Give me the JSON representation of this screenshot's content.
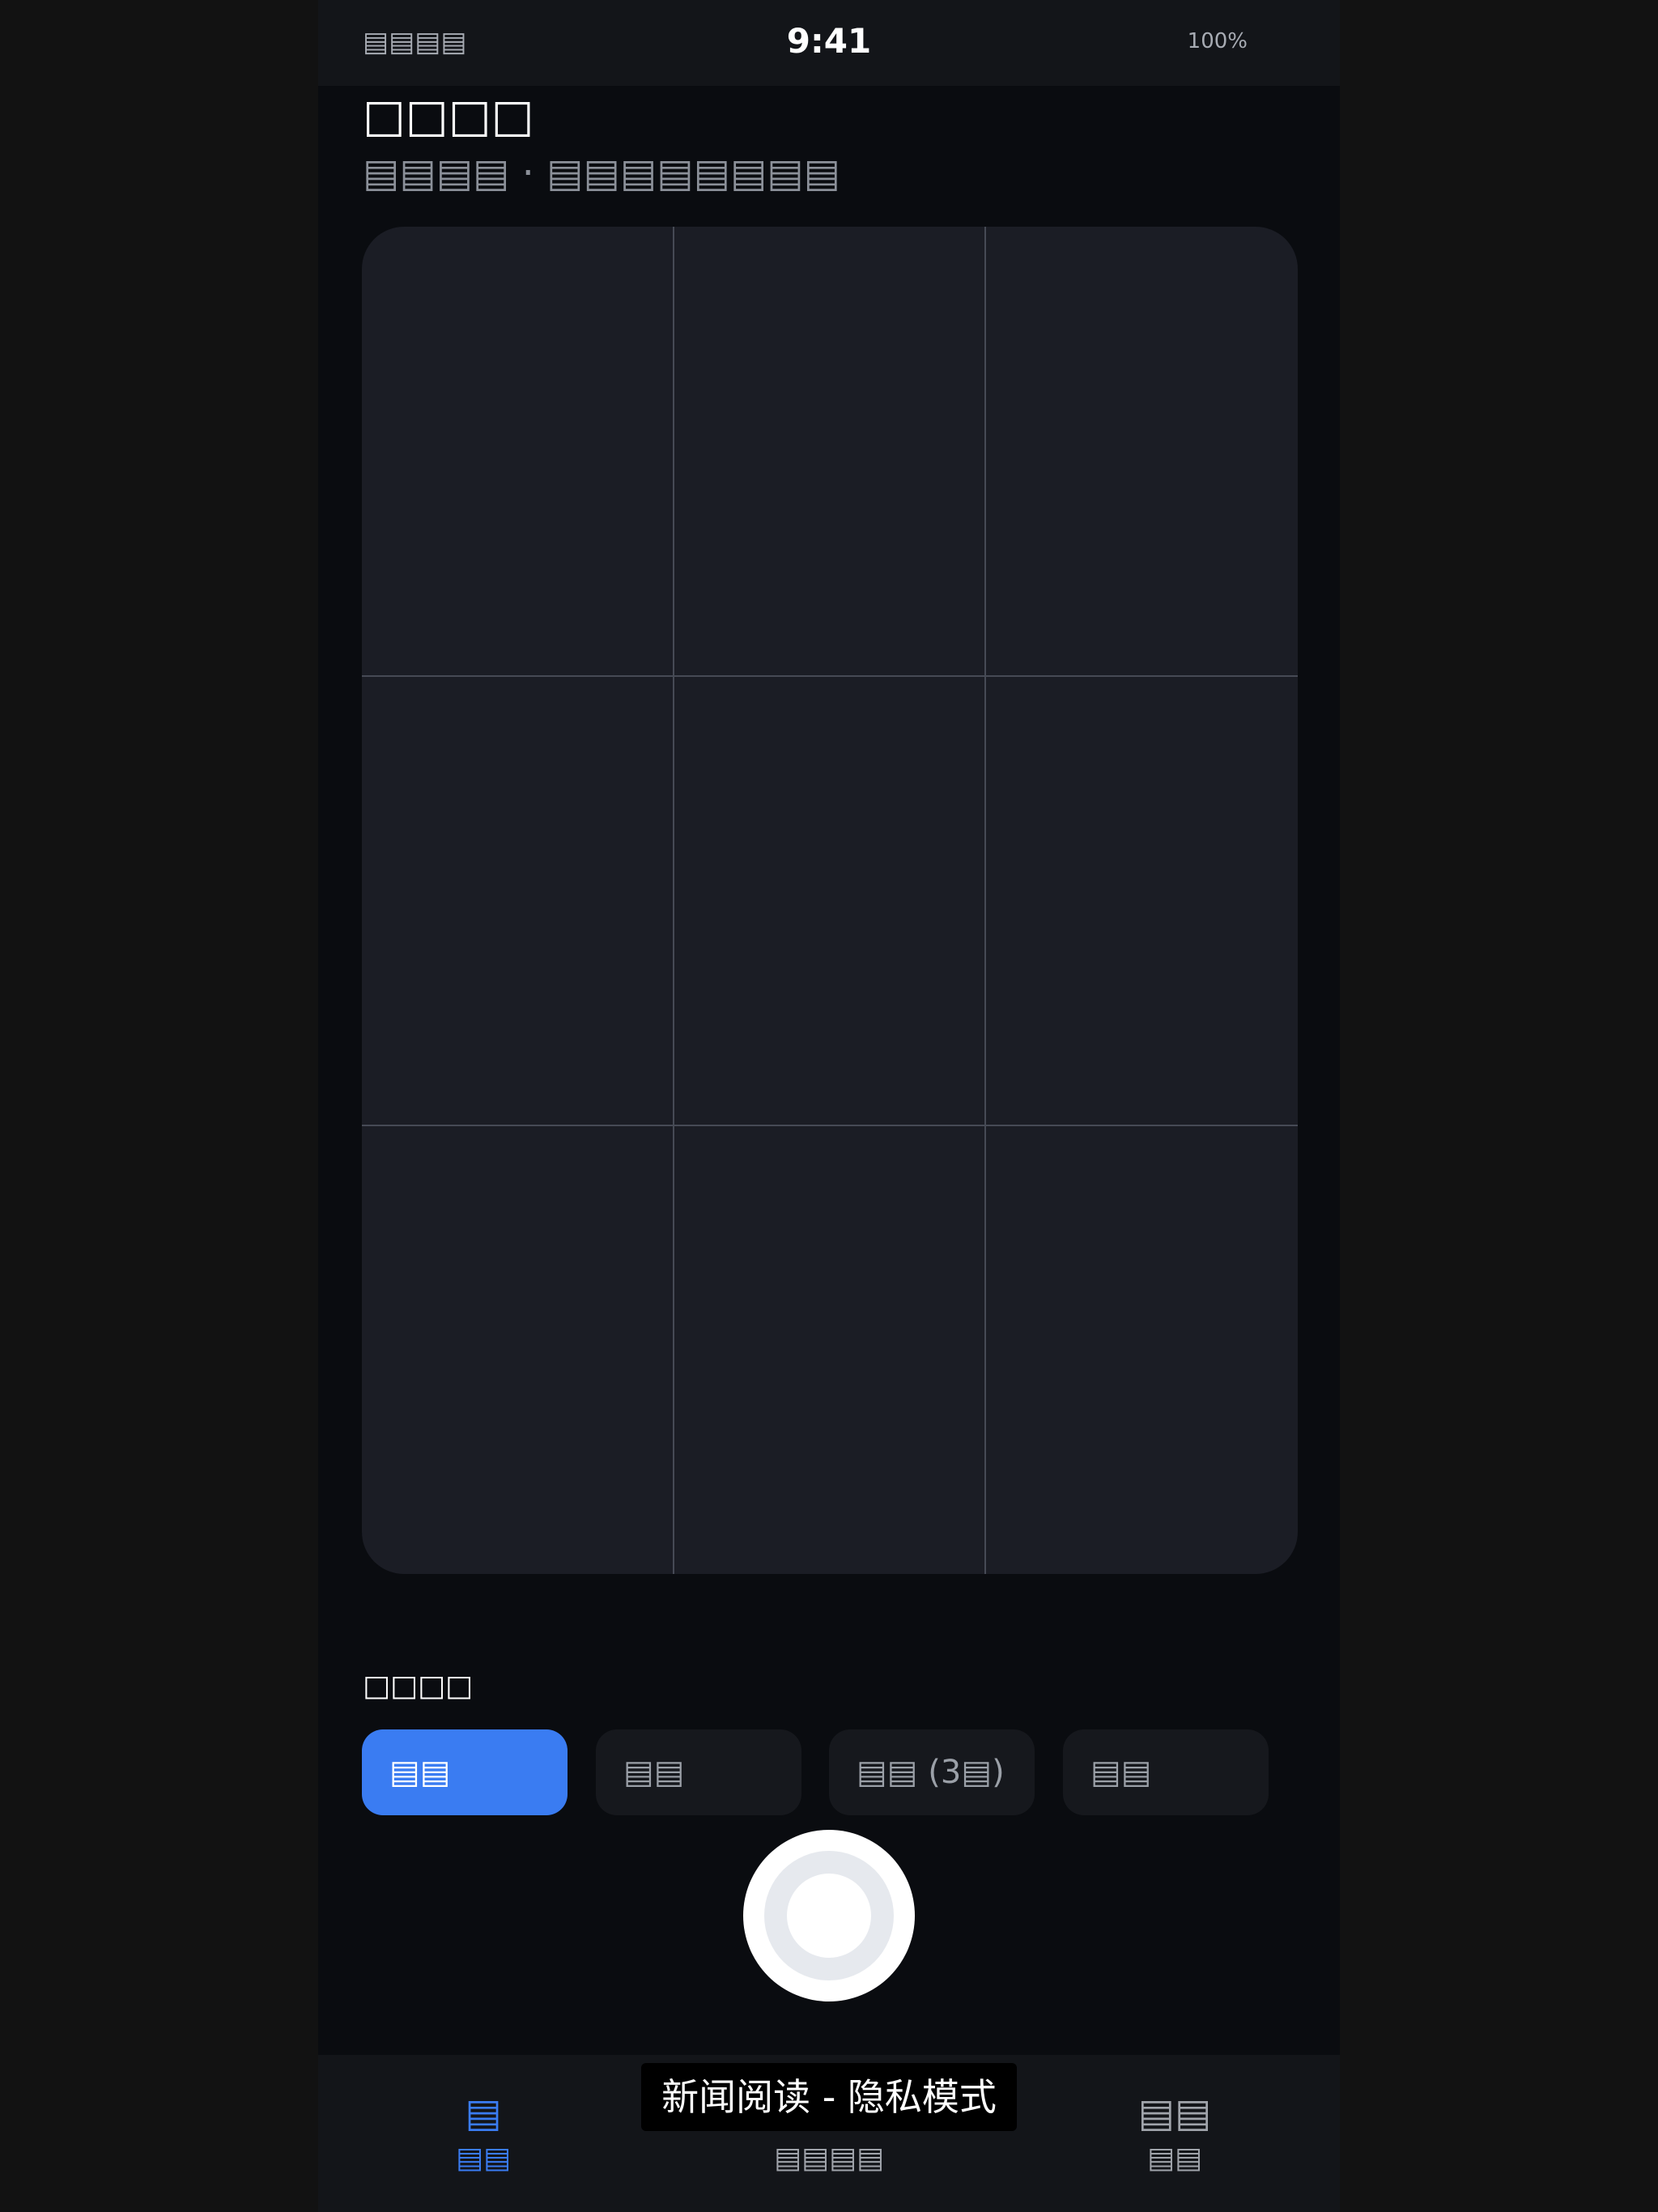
{
  "status_bar": {
    "carrier": "▤▤▤▤",
    "time": "9:41",
    "battery": "100%"
  },
  "header": {
    "title": "□□□□",
    "subtitle": "▤▤▤▤ · ▤▤▤▤▤▤▤▤"
  },
  "capture": {
    "mode_label": "□□□□",
    "modes": [
      {
        "label": "▤▤",
        "active": true
      },
      {
        "label": "▤▤",
        "active": false
      },
      {
        "label": "▤▤ (3▤)",
        "active": false
      },
      {
        "label": "▤▤",
        "active": false
      }
    ]
  },
  "tab_bar": {
    "tabs": [
      {
        "icon": "▤",
        "label": "▤▤",
        "active": true
      },
      {
        "icon": "▤",
        "label": "▤▤▤▤",
        "active": false
      },
      {
        "icon": "▤▤",
        "label": "▤▤",
        "active": false
      }
    ]
  },
  "toast": {
    "text": "新闻阅读 - 隐私模式"
  },
  "colors": {
    "accent": "#3a7cf2",
    "screen_background": "#0a0c10",
    "viewfinder_background": "#1b1d25",
    "grid_line": "#464a55"
  },
  "icons": {
    "shutter": "shutter-button-icon",
    "grid": "grid-overlay"
  }
}
